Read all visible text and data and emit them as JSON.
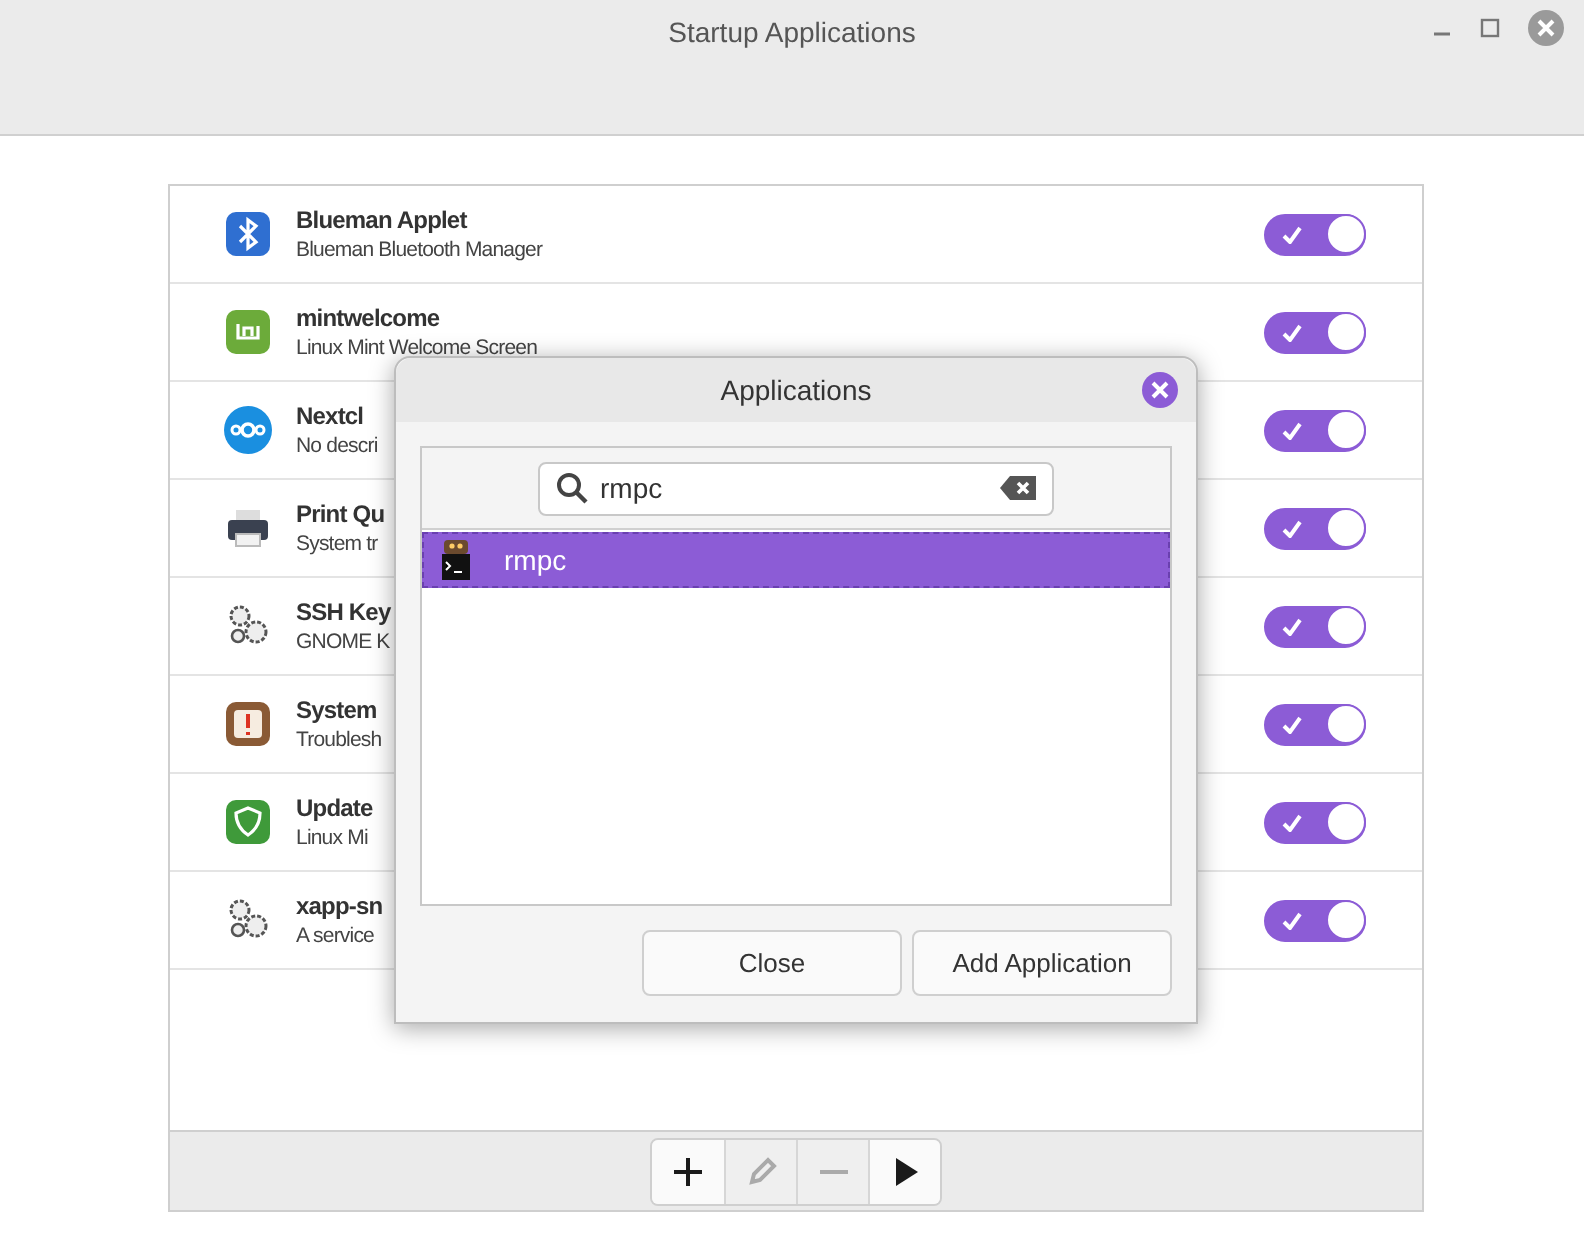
{
  "window": {
    "title": "Startup Applications"
  },
  "apps": [
    {
      "name": "Blueman Applet",
      "description": "Blueman Bluetooth Manager",
      "kind": "bluetooth",
      "on": true
    },
    {
      "name": "mintwelcome",
      "description": "Linux Mint Welcome Screen",
      "kind": "mint",
      "on": true
    },
    {
      "name": "Nextcl",
      "description": "No descri",
      "kind": "cloud",
      "on": true
    },
    {
      "name": "Print Qu",
      "description": "System tr",
      "kind": "printer",
      "on": true
    },
    {
      "name": "SSH Key",
      "description": "GNOME K",
      "kind": "gears",
      "on": true
    },
    {
      "name": "System",
      "description": "Troublesh",
      "kind": "warning",
      "on": true
    },
    {
      "name": "Update",
      "description": "Linux Mi",
      "kind": "shield",
      "on": true
    },
    {
      "name": "xapp-sn",
      "description": "A service",
      "kind": "gears",
      "on": true
    }
  ],
  "toolbar": [
    {
      "kind": "add",
      "disabled": false
    },
    {
      "kind": "edit",
      "disabled": true
    },
    {
      "kind": "remove",
      "disabled": true
    },
    {
      "kind": "run",
      "disabled": false
    }
  ],
  "dialog": {
    "title": "Applications",
    "search": {
      "value": "rmpc"
    },
    "results": [
      {
        "label": "rmpc",
        "selected": true
      }
    ],
    "buttons": [
      "Close",
      "Add Application"
    ]
  }
}
